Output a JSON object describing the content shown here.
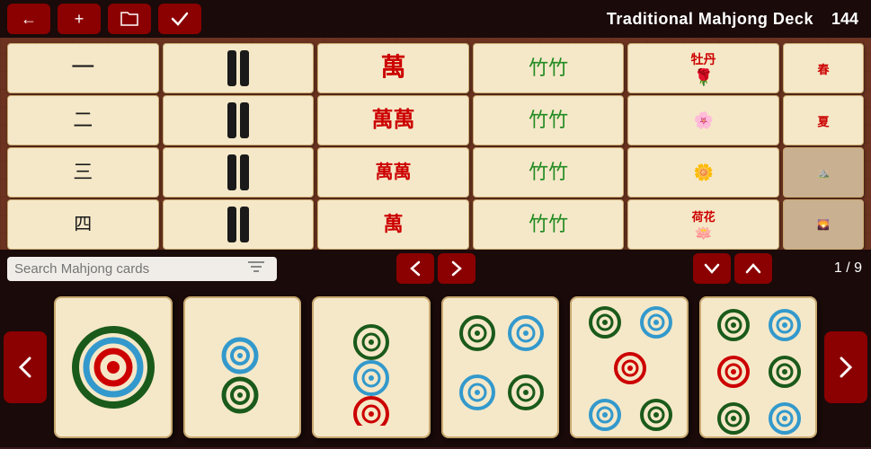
{
  "toolbar": {
    "back_label": "←",
    "add_label": "+",
    "folder_label": "⊡",
    "check_label": "✓",
    "deck_title": "Traditional Mahjong Deck",
    "card_count": "144"
  },
  "bottom_controls": {
    "search_placeholder": "Search Mahjong cards",
    "prev_label": "❮",
    "next_label": "❯",
    "down_label": "∨",
    "up_label": "∧",
    "page_indicator": "1 / 9"
  },
  "tray": {
    "left_label": "❮",
    "right_label": "❯"
  },
  "colors": {
    "dark_red": "#8b0000",
    "bg_dark": "#1a0a0a",
    "card_bg": "#f5e8c8",
    "wood": "#6b3320"
  }
}
